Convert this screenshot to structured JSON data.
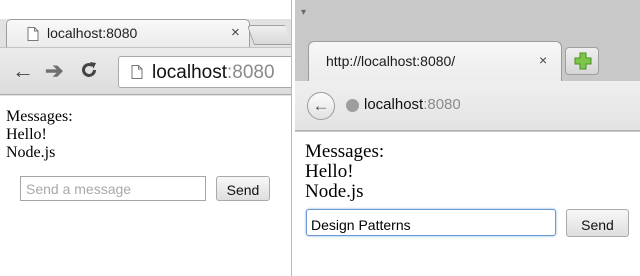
{
  "left_window": {
    "tab_title": "localhost:8080",
    "tab_close": "×",
    "address": {
      "host": "localhost",
      "port": ":8080"
    },
    "nav": {
      "back": "←",
      "forward": "➔",
      "reload": "C"
    },
    "content": {
      "heading": "Messages:",
      "messages": [
        "Hello!",
        "Node.js"
      ],
      "input": {
        "value": "",
        "placeholder": "Send a message"
      },
      "send_label": "Send"
    }
  },
  "right_window": {
    "menu_glyph": "▾",
    "tab_title": "http://localhost:8080/",
    "tab_close": "×",
    "address": {
      "host": "localhost",
      "port": ":8080"
    },
    "nav": {
      "back": "←"
    },
    "content": {
      "heading": "Messages:",
      "messages": [
        "Hello!",
        "Node.js"
      ],
      "input": {
        "value": "Design Patterns",
        "placeholder": ""
      },
      "send_label": "Send"
    }
  },
  "colors": {
    "new_tab_plus": "#7cc64a",
    "focus_ring": "#6c9bd4"
  }
}
